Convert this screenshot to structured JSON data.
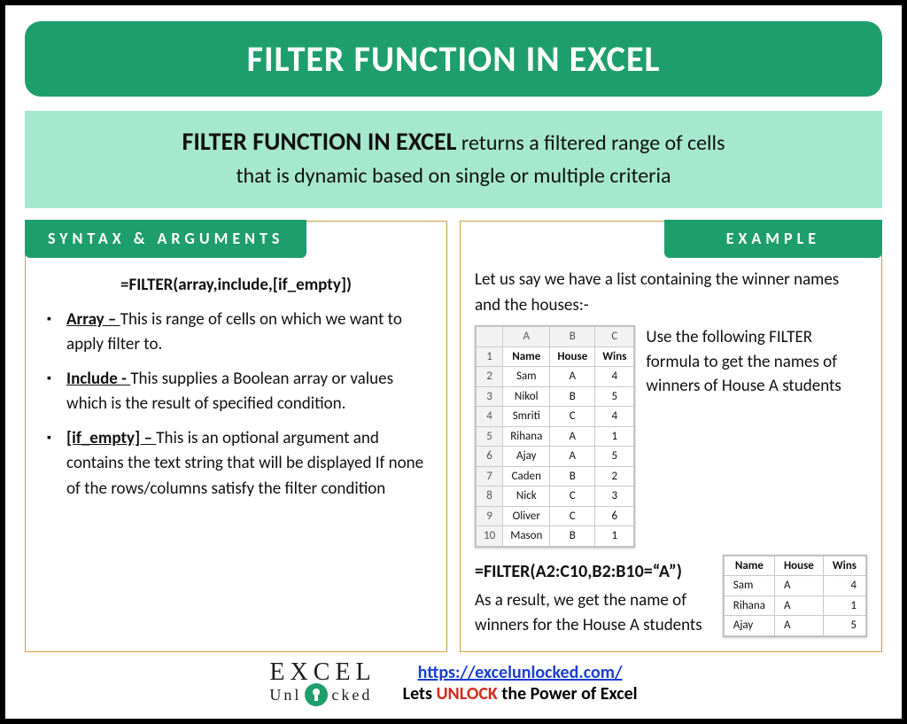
{
  "title": "FILTER FUNCTION IN EXCEL",
  "description": {
    "lead": "FILTER FUNCTION IN EXCEL",
    "rest1": " returns a filtered range of cells",
    "rest2": "that is dynamic based on single or multiple criteria"
  },
  "syntax_panel": {
    "heading": "SYNTAX & ARGUMENTS",
    "formula": "=FILTER(array,include,[if_empty])",
    "args": [
      {
        "name": "Array – ",
        "text": "This is range of cells on which we want to apply filter to."
      },
      {
        "name": "Include -  ",
        "text": "This supplies a Boolean array or values which is the result of specified condition."
      },
      {
        "name": "[if_empty] – ",
        "text": "This is an optional argument and contains the text string that will be displayed If none of the rows/columns satisfy the filter condition"
      }
    ]
  },
  "example_panel": {
    "heading": "EXAMPLE",
    "intro": "Let us say we have a list containing the winner names and the houses:-",
    "source_sheet": {
      "col_headers": [
        "",
        "A",
        "B",
        "C"
      ],
      "data_headers": [
        "Name",
        "House",
        "Wins"
      ],
      "rows": [
        [
          "1",
          "Name",
          "House",
          "Wins"
        ],
        [
          "2",
          "Sam",
          "A",
          "4"
        ],
        [
          "3",
          "Nikol",
          "B",
          "5"
        ],
        [
          "4",
          "Smriti",
          "C",
          "4"
        ],
        [
          "5",
          "Rihana",
          "A",
          "1"
        ],
        [
          "6",
          "Ajay",
          "A",
          "5"
        ],
        [
          "7",
          "Caden",
          "B",
          "2"
        ],
        [
          "8",
          "Nick",
          "C",
          "3"
        ],
        [
          "9",
          "Oliver",
          "C",
          "6"
        ],
        [
          "10",
          "Mason",
          "B",
          "1"
        ]
      ]
    },
    "side_text": "Use the following FILTER formula to get the names of winners of House A students",
    "formula": "=FILTER(A2:C10,B2:B10=“A”)",
    "result_intro": "As a result, we get the name of winners for the House A students",
    "result_sheet": {
      "headers": [
        "Name",
        "House",
        "Wins"
      ],
      "rows": [
        [
          "Sam",
          "A",
          "4"
        ],
        [
          "Rihana",
          "A",
          "1"
        ],
        [
          "Ajay",
          "A",
          "5"
        ]
      ]
    }
  },
  "footer": {
    "logo_top": "EXCEL",
    "logo_bottom": "Unlocked",
    "url": "https://excelunlocked.com/",
    "tagline_pre": "Lets ",
    "tagline_mid": "UNLOCK",
    "tagline_post": " the Power of Excel"
  }
}
